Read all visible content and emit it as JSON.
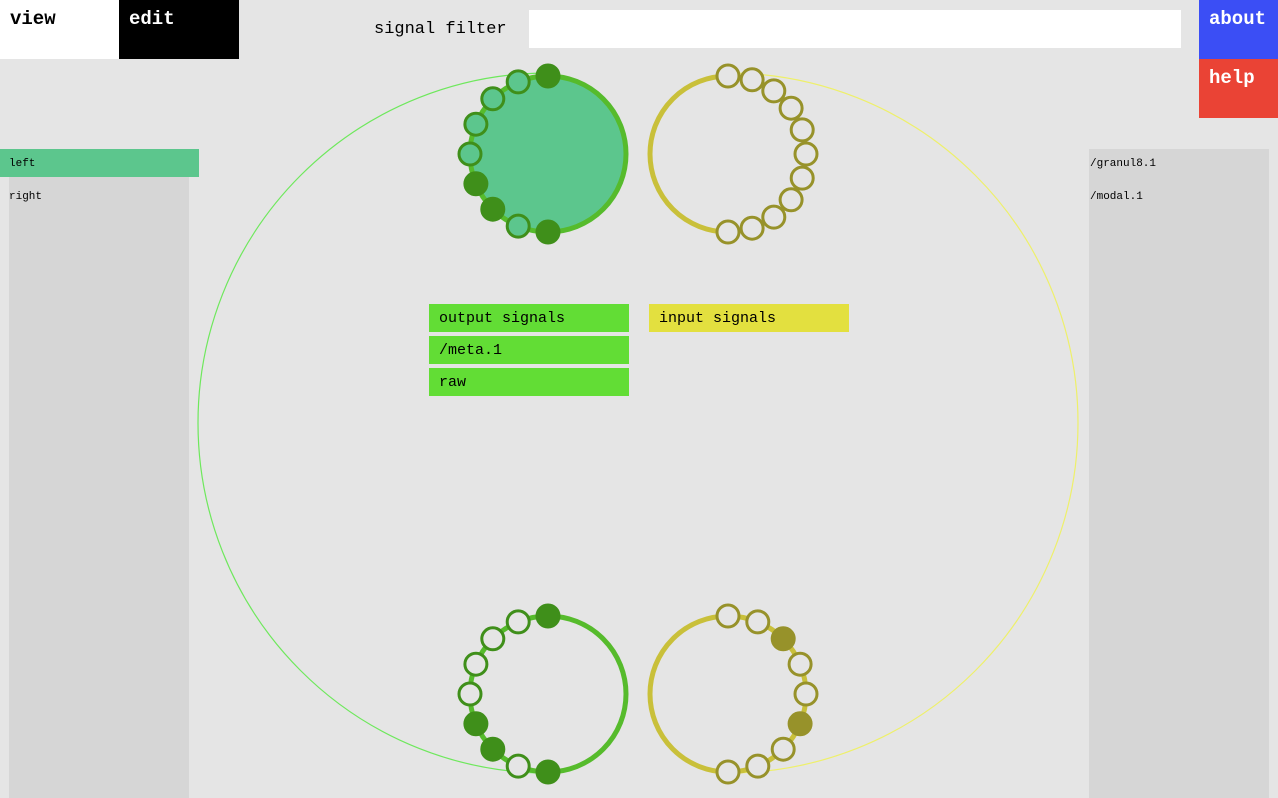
{
  "nav": {
    "view_label": "view",
    "edit_label": "edit",
    "about_label": "about",
    "help_label": "help"
  },
  "filter": {
    "label": "signal filter",
    "value": "",
    "placeholder": ""
  },
  "left_devices": [
    "left",
    "right"
  ],
  "right_devices": [
    "/granul8.1",
    "/modal.1"
  ],
  "output_list": {
    "header": "output signals",
    "items": [
      "/meta.1",
      "raw"
    ]
  },
  "input_list": {
    "header": "input signals"
  },
  "colors": {
    "output": "#62dd35",
    "output_dark": "#3f8f1a",
    "output_ring": "#56bb2c",
    "input": "#e3e03f",
    "input_dark": "#97922a",
    "input_ring": "#c9c03a",
    "selected_device": "#5cc68d",
    "about": "#3b4ef5",
    "help": "#ea4335"
  },
  "nodes": [
    {
      "side": "output",
      "position": "top",
      "filled": true,
      "ports": [
        true,
        false,
        false,
        false,
        false,
        true,
        true,
        false,
        true
      ]
    },
    {
      "side": "input",
      "position": "top",
      "filled": false,
      "ports": [
        false,
        false,
        false,
        false,
        false,
        false,
        false,
        false,
        false,
        false,
        false
      ]
    },
    {
      "side": "output",
      "position": "bottom",
      "filled": false,
      "ports": [
        true,
        false,
        false,
        false,
        false,
        true,
        true,
        false,
        true
      ]
    },
    {
      "side": "input",
      "position": "bottom",
      "filled": false,
      "ports": [
        false,
        false,
        true,
        false,
        false,
        true,
        false,
        false,
        false
      ]
    }
  ]
}
